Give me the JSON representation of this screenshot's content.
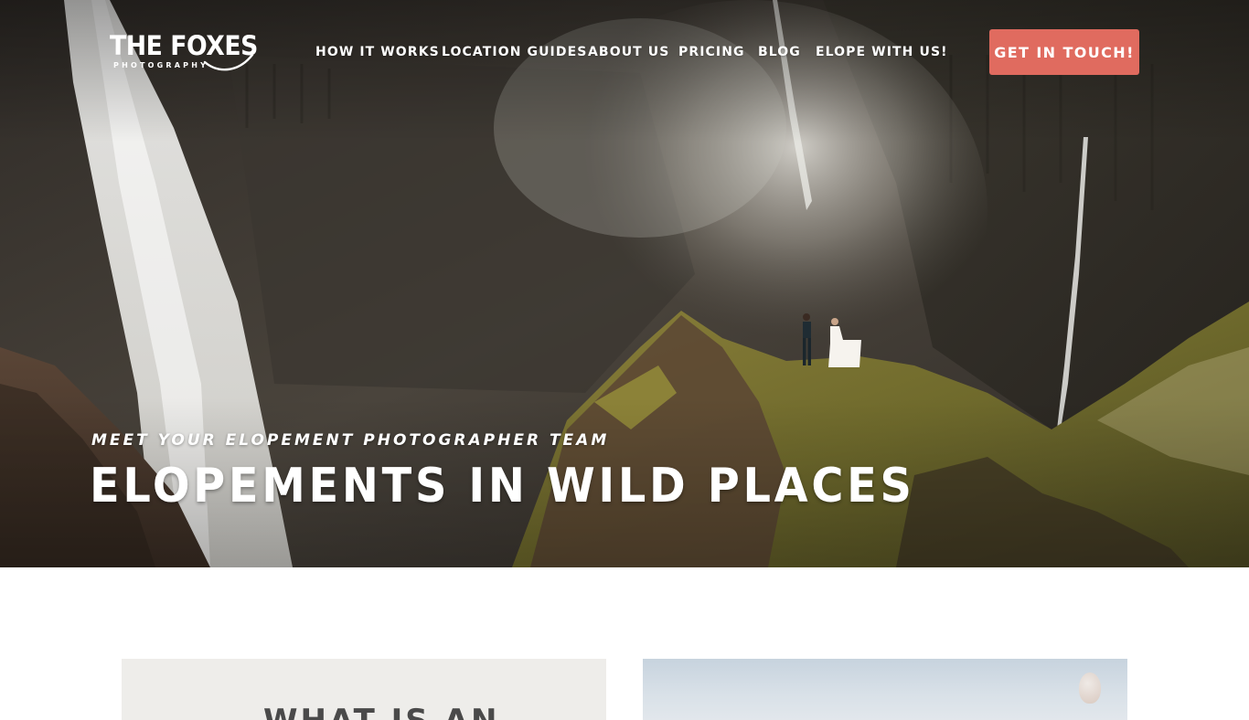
{
  "brand": {
    "name": "THE FOXES",
    "tagline": "PHOTOGRAPHY"
  },
  "nav": {
    "items": [
      {
        "label": "HOW IT WORKS"
      },
      {
        "label": "LOCATION GUIDES"
      },
      {
        "label": "ABOUT US"
      },
      {
        "label": "PRICING"
      },
      {
        "label": "BLOG"
      },
      {
        "label": "ELOPE WITH US!"
      }
    ],
    "cta_label": "GET IN TOUCH!"
  },
  "hero": {
    "eyebrow": "MEET YOUR ELOPEMENT PHOTOGRAPHER TEAM",
    "headline": "ELOPEMENTS IN WILD PLACES"
  },
  "intro": {
    "card_title": "WHAT IS AN"
  },
  "colors": {
    "accent": "#e06b5f",
    "card_bg": "#eeedea",
    "text_dark": "#4a4a4a"
  }
}
